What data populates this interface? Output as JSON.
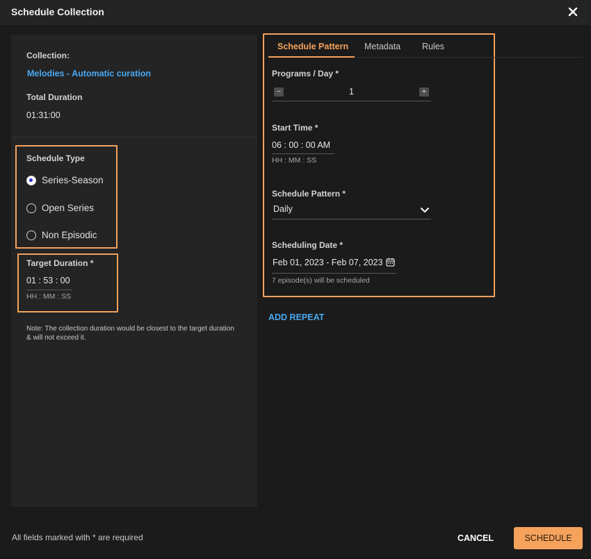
{
  "dialog": {
    "title": "Schedule Collection"
  },
  "collection": {
    "label": "Collection:",
    "name": "Melodies - Automatic curation",
    "total_duration_label": "Total Duration",
    "total_duration": "01:31:00"
  },
  "schedule_type": {
    "label": "Schedule Type",
    "options": [
      {
        "label": "Series-Season",
        "checked": true
      },
      {
        "label": "Open Series",
        "checked": false
      },
      {
        "label": "Non Episodic",
        "checked": false
      }
    ]
  },
  "target_duration": {
    "label": "Target Duration *",
    "value": "01 : 53 : 00",
    "format": "HH : MM : SS"
  },
  "note": "Note: The collection duration would be closest to the target duration & will not exceed it.",
  "tabs": [
    {
      "label": "Schedule Pattern",
      "active": true
    },
    {
      "label": "Metadata",
      "active": false
    },
    {
      "label": "Rules",
      "active": false
    }
  ],
  "programs_per_day": {
    "label": "Programs / Day *",
    "value": "1",
    "minus": "−",
    "plus": "+"
  },
  "start_time": {
    "label": "Start Time *",
    "value": "06 : 00 : 00 AM",
    "format": "HH : MM : SS"
  },
  "schedule_pattern": {
    "label": "Schedule Pattern *",
    "value": "Daily"
  },
  "scheduling_date": {
    "label": "Scheduling Date *",
    "value": "Feb 01, 2023 - Feb 07, 2023",
    "helper": "7 episode(s) will be scheduled"
  },
  "add_repeat": "ADD REPEAT",
  "footer": {
    "required_note": "All fields marked with * are required",
    "cancel": "CANCEL",
    "schedule": "SCHEDULE"
  },
  "colors": {
    "accent": "#f5a25d",
    "link": "#4aa8f0",
    "background": "#1b1b1b",
    "panel": "#242424"
  },
  "icons": {
    "close": "close-icon",
    "chevron": "chevron-down-icon",
    "calendar": "calendar-icon"
  }
}
